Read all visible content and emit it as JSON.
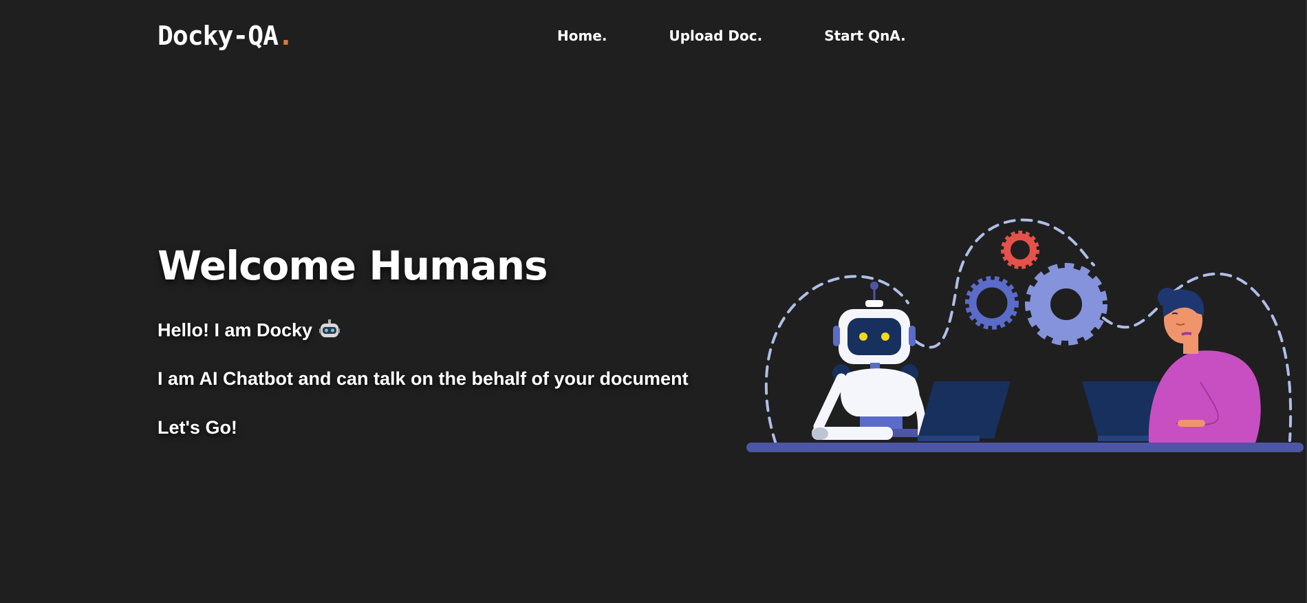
{
  "header": {
    "logo_text": "Docky-QA",
    "logo_dot": ".",
    "nav": {
      "home": "Home.",
      "upload": "Upload Doc.",
      "start": "Start QnA."
    }
  },
  "hero": {
    "title": "Welcome Humans",
    "greeting": "Hello! I am Docky",
    "description": "I am AI Chatbot and can talk on the behalf of your document",
    "cta": "Let's Go!"
  },
  "colors": {
    "background": "#1f1f1f",
    "accent_dot": "#e07b39",
    "desk": "#4d55a6",
    "gear_red": "#e4524a",
    "gear_blue": "#5b6bc9",
    "gear_light": "#8593dc",
    "laptop": "#17305e",
    "person_shirt": "#c84fc1"
  },
  "icons": {
    "greeting_emoji": "robot-face-icon"
  }
}
